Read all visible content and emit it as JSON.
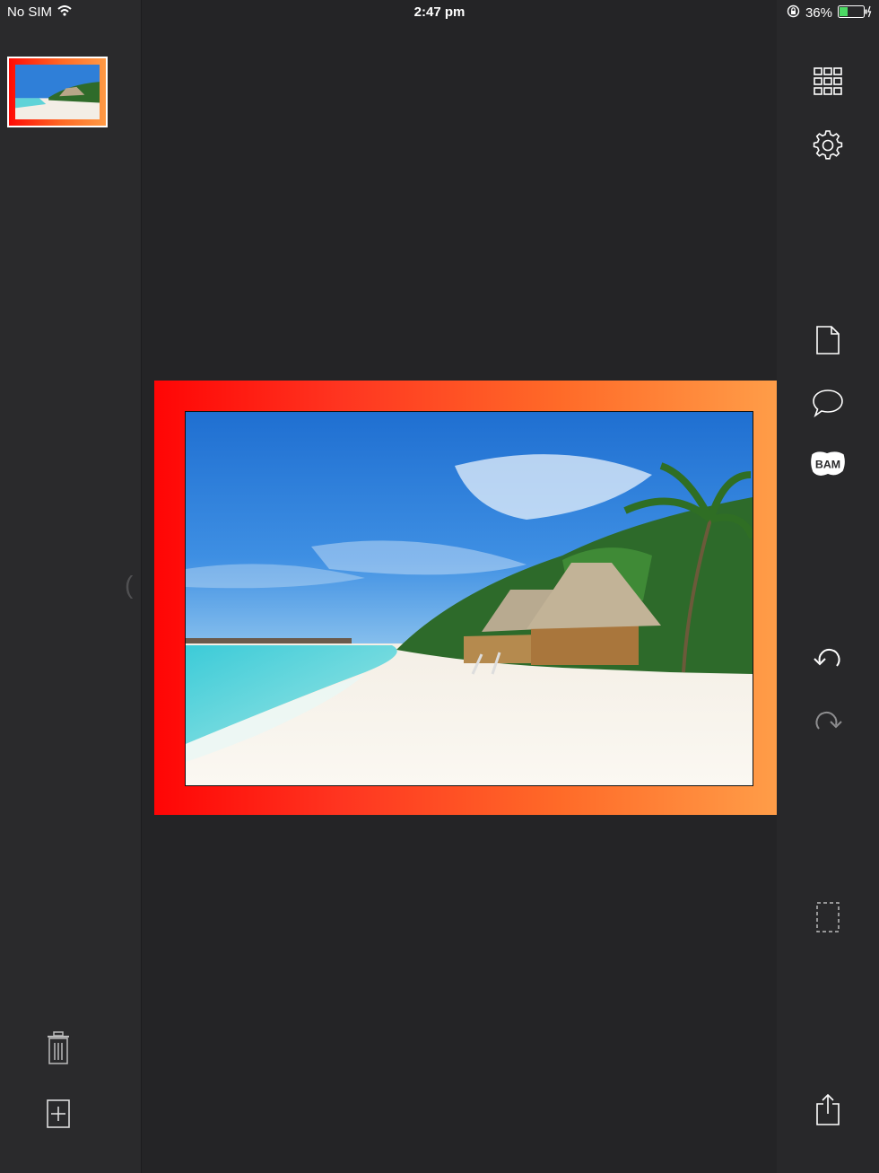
{
  "status": {
    "carrier": "No SIM",
    "time": "2:47 pm",
    "battery": "36%"
  },
  "colors": {
    "frame_left": "#ff0505",
    "frame_right": "#ff9d48",
    "background": "#242426",
    "battery_fill": "#4cd964"
  },
  "battery_level": 0.36,
  "sidebar": {
    "thumbnail_icon": "beach-photo-thumbnail",
    "bottom_icons": [
      "trash-icon",
      "add-page-icon"
    ],
    "collapse_handle": "("
  },
  "toolbar": {
    "icons": [
      "grid-icon",
      "gear-icon",
      "new-page-icon",
      "speech-bubble-icon",
      "text-sticker-icon",
      "undo-icon",
      "redo-icon",
      "crop-select-icon",
      "share-icon"
    ],
    "sticker_label": "BAM"
  },
  "canvas": {
    "content": "beach-photo",
    "frame": "orange-red-gradient"
  }
}
